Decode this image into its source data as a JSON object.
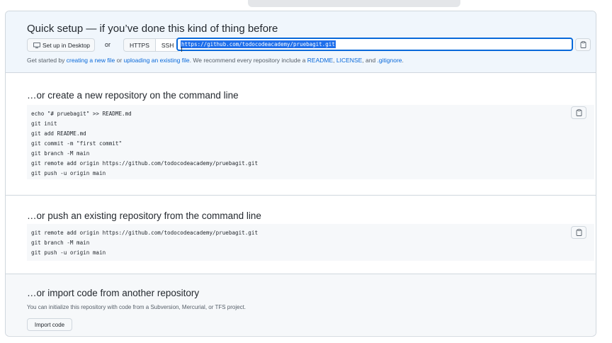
{
  "quick_setup": {
    "title": "Quick setup — if you’ve done this kind of thing before",
    "desktop_label": "Set up in Desktop",
    "or_label": "or",
    "https_label": "HTTPS",
    "ssh_label": "SSH",
    "url": "https://github.com/todocodeacademy/pruebagit.git",
    "hint_prefix": "Get started by ",
    "hint_link_new": "creating a new file",
    "hint_or": " or ",
    "hint_link_upload": "uploading an existing file",
    "hint_middle": ". We recommend every repository include a ",
    "hint_link_readme": "README",
    "hint_comma1": ", ",
    "hint_link_license": "LICENSE",
    "hint_and": ", and ",
    "hint_link_gitignore": ".gitignore",
    "hint_end": "."
  },
  "create_section": {
    "title": "…or create a new repository on the command line",
    "lines": [
      "echo \"# pruebagit\" >> README.md",
      "git init",
      "git add README.md",
      "git commit -m \"first commit\"",
      "git branch -M main",
      "git remote add origin https://github.com/todocodeacademy/pruebagit.git",
      "git push -u origin main"
    ]
  },
  "push_section": {
    "title": "…or push an existing repository from the command line",
    "lines": [
      "git remote add origin https://github.com/todocodeacademy/pruebagit.git",
      "git branch -M main",
      "git push -u origin main"
    ]
  },
  "import_section": {
    "title": "…or import code from another repository",
    "description": "You can initialize this repository with code from a Subversion, Mercurial, or TFS project.",
    "button_label": "Import code"
  },
  "icons": {
    "desktop": "desktop-icon",
    "copy": "copy-icon"
  }
}
